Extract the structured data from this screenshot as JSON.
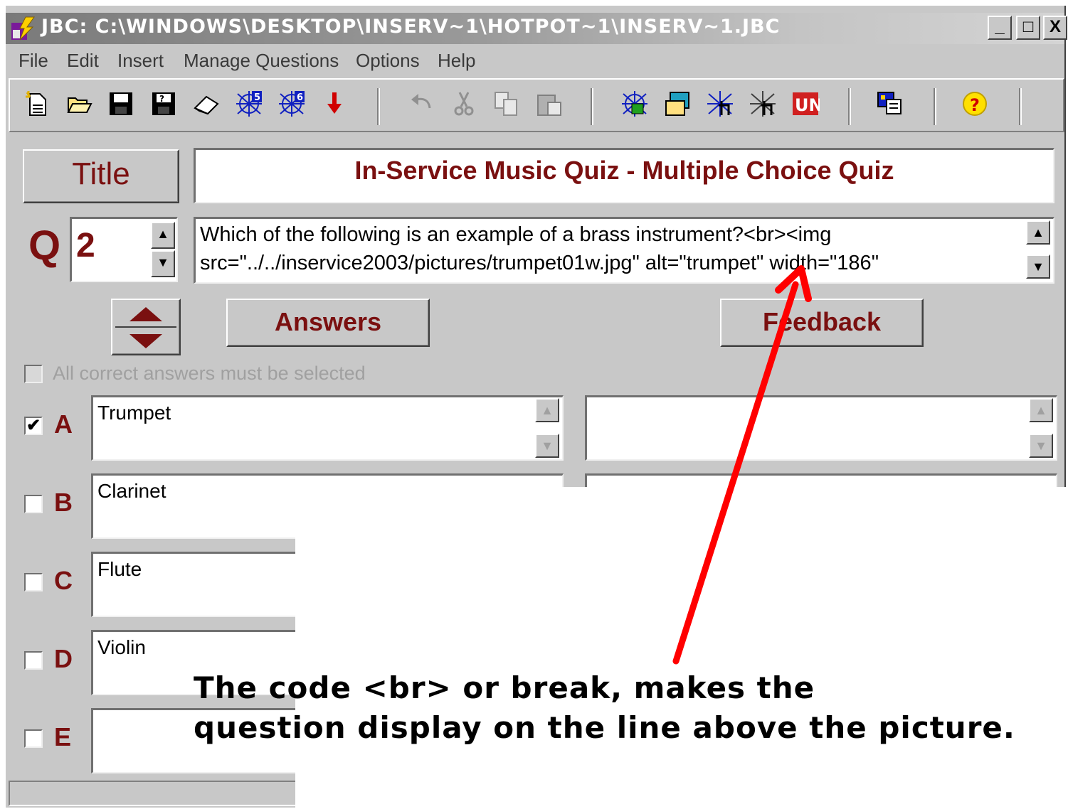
{
  "window": {
    "title": "JBC: C:\\WINDOWS\\DESKTOP\\INSERV~1\\HOTPOT~1\\INSERV~1.JBC",
    "minimize": "_",
    "maximize": "□",
    "close": "X"
  },
  "menu": [
    {
      "label": "File"
    },
    {
      "label": "Edit"
    },
    {
      "label": "Insert"
    },
    {
      "label": "Manage Questions"
    },
    {
      "label": "Options"
    },
    {
      "label": "Help"
    }
  ],
  "toolbar": {
    "icons": [
      "new-file-icon",
      "open-folder-icon",
      "save-icon",
      "save-as-icon",
      "eraser-icon",
      "web-page-v5-icon",
      "web-page-v6-icon",
      "export-arrow-icon",
      "undo-icon",
      "cut-icon",
      "copy-icon",
      "paste-icon",
      "web-icon",
      "image-icon",
      "java-icon",
      "drag-drop-icon",
      "unicode-icon",
      "config-icon",
      "help-icon"
    ]
  },
  "quiz": {
    "title_button": "Title",
    "title_value": "In-Service Music Quiz - Multiple Choice Quiz",
    "q_label": "Q",
    "q_number": "2",
    "question_line1": "Which of the following is an example of a brass instrument?<br><img",
    "question_line2": "src=\"../../inservice2003/pictures/trumpet01w.jpg\" alt=\"trumpet\" width=\"186\"",
    "answers_button": "Answers",
    "feedback_button": "Feedback",
    "all_correct_label": "All correct answers must be selected",
    "answers": [
      {
        "letter": "A",
        "text": "Trumpet",
        "checked": true
      },
      {
        "letter": "B",
        "text": "Clarinet",
        "checked": false
      },
      {
        "letter": "C",
        "text": "Flute",
        "checked": false
      },
      {
        "letter": "D",
        "text": "Violin",
        "checked": false
      },
      {
        "letter": "E",
        "text": "",
        "checked": false
      }
    ]
  },
  "annotation": {
    "line1": "The code <br> or break, makes the",
    "line2": "question display on the line above the picture.",
    "arrow_color": "#ff0000"
  },
  "colors": {
    "maroon": "#7a1010",
    "face": "#c8c8c8"
  }
}
